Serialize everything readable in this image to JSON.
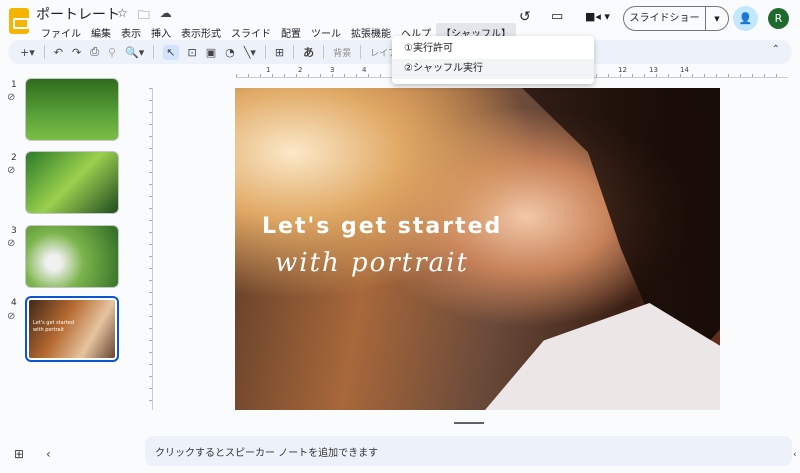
{
  "doc_title": "ポートレート",
  "menu": [
    "ファイル",
    "編集",
    "表示",
    "挿入",
    "表示形式",
    "スライド",
    "配置",
    "ツール",
    "拡張機能",
    "ヘルプ",
    "【シャッフル】"
  ],
  "dropdown": [
    "①実行許可",
    "②シャッフル実行"
  ],
  "toolbar": {
    "background": "背景",
    "layout": "レイアウ",
    "hiragana": "あ"
  },
  "slideshow_label": "スライドショー",
  "avatar_letter": "R",
  "ruler_ticks": [
    "1",
    "2",
    "3",
    "4",
    "12",
    "13",
    "14"
  ],
  "slides": [
    {
      "num": "1"
    },
    {
      "num": "2"
    },
    {
      "num": "3"
    },
    {
      "num": "4",
      "caption": "Let's get started with portrait"
    }
  ],
  "slide": {
    "line1": "Let's get started",
    "line2": "with portrait"
  },
  "notes_placeholder": "クリックするとスピーカー ノートを追加できます"
}
